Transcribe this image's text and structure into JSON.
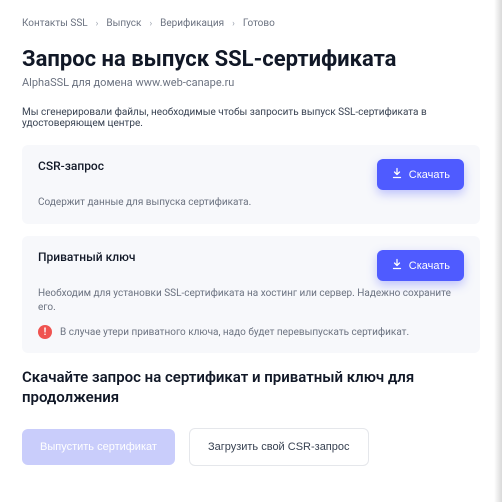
{
  "breadcrumb": {
    "items": [
      "Контакты SSL",
      "Выпуск",
      "Верификация",
      "Готово"
    ]
  },
  "header": {
    "title": "Запрос на выпуск SSL-сертификата",
    "subtitle": "AlphaSSL для домена www.web-canape.ru"
  },
  "intro": "Мы сгенерировали файлы, необходимые чтобы запросить выпуск SSL-сертификата в удостоверяющем центре.",
  "cards": {
    "csr": {
      "title": "CSR-запрос",
      "desc": "Содержит данные для выпуска сертификата.",
      "download": "Скачать"
    },
    "key": {
      "title": "Приватный ключ",
      "desc": "Необходим для установки SSL-сертификата на хостинг или сервер. Надежно сохраните его.",
      "download": "Скачать",
      "warning": "В случае утери приватного ключа, надо будет перевыпускать сертификат."
    }
  },
  "continue_heading": "Скачайте запрос на сертификат и приватный ключ для продолжения",
  "actions": {
    "issue": "Выпустить сертификат",
    "upload": "Загрузить свой CSR-запрос"
  }
}
